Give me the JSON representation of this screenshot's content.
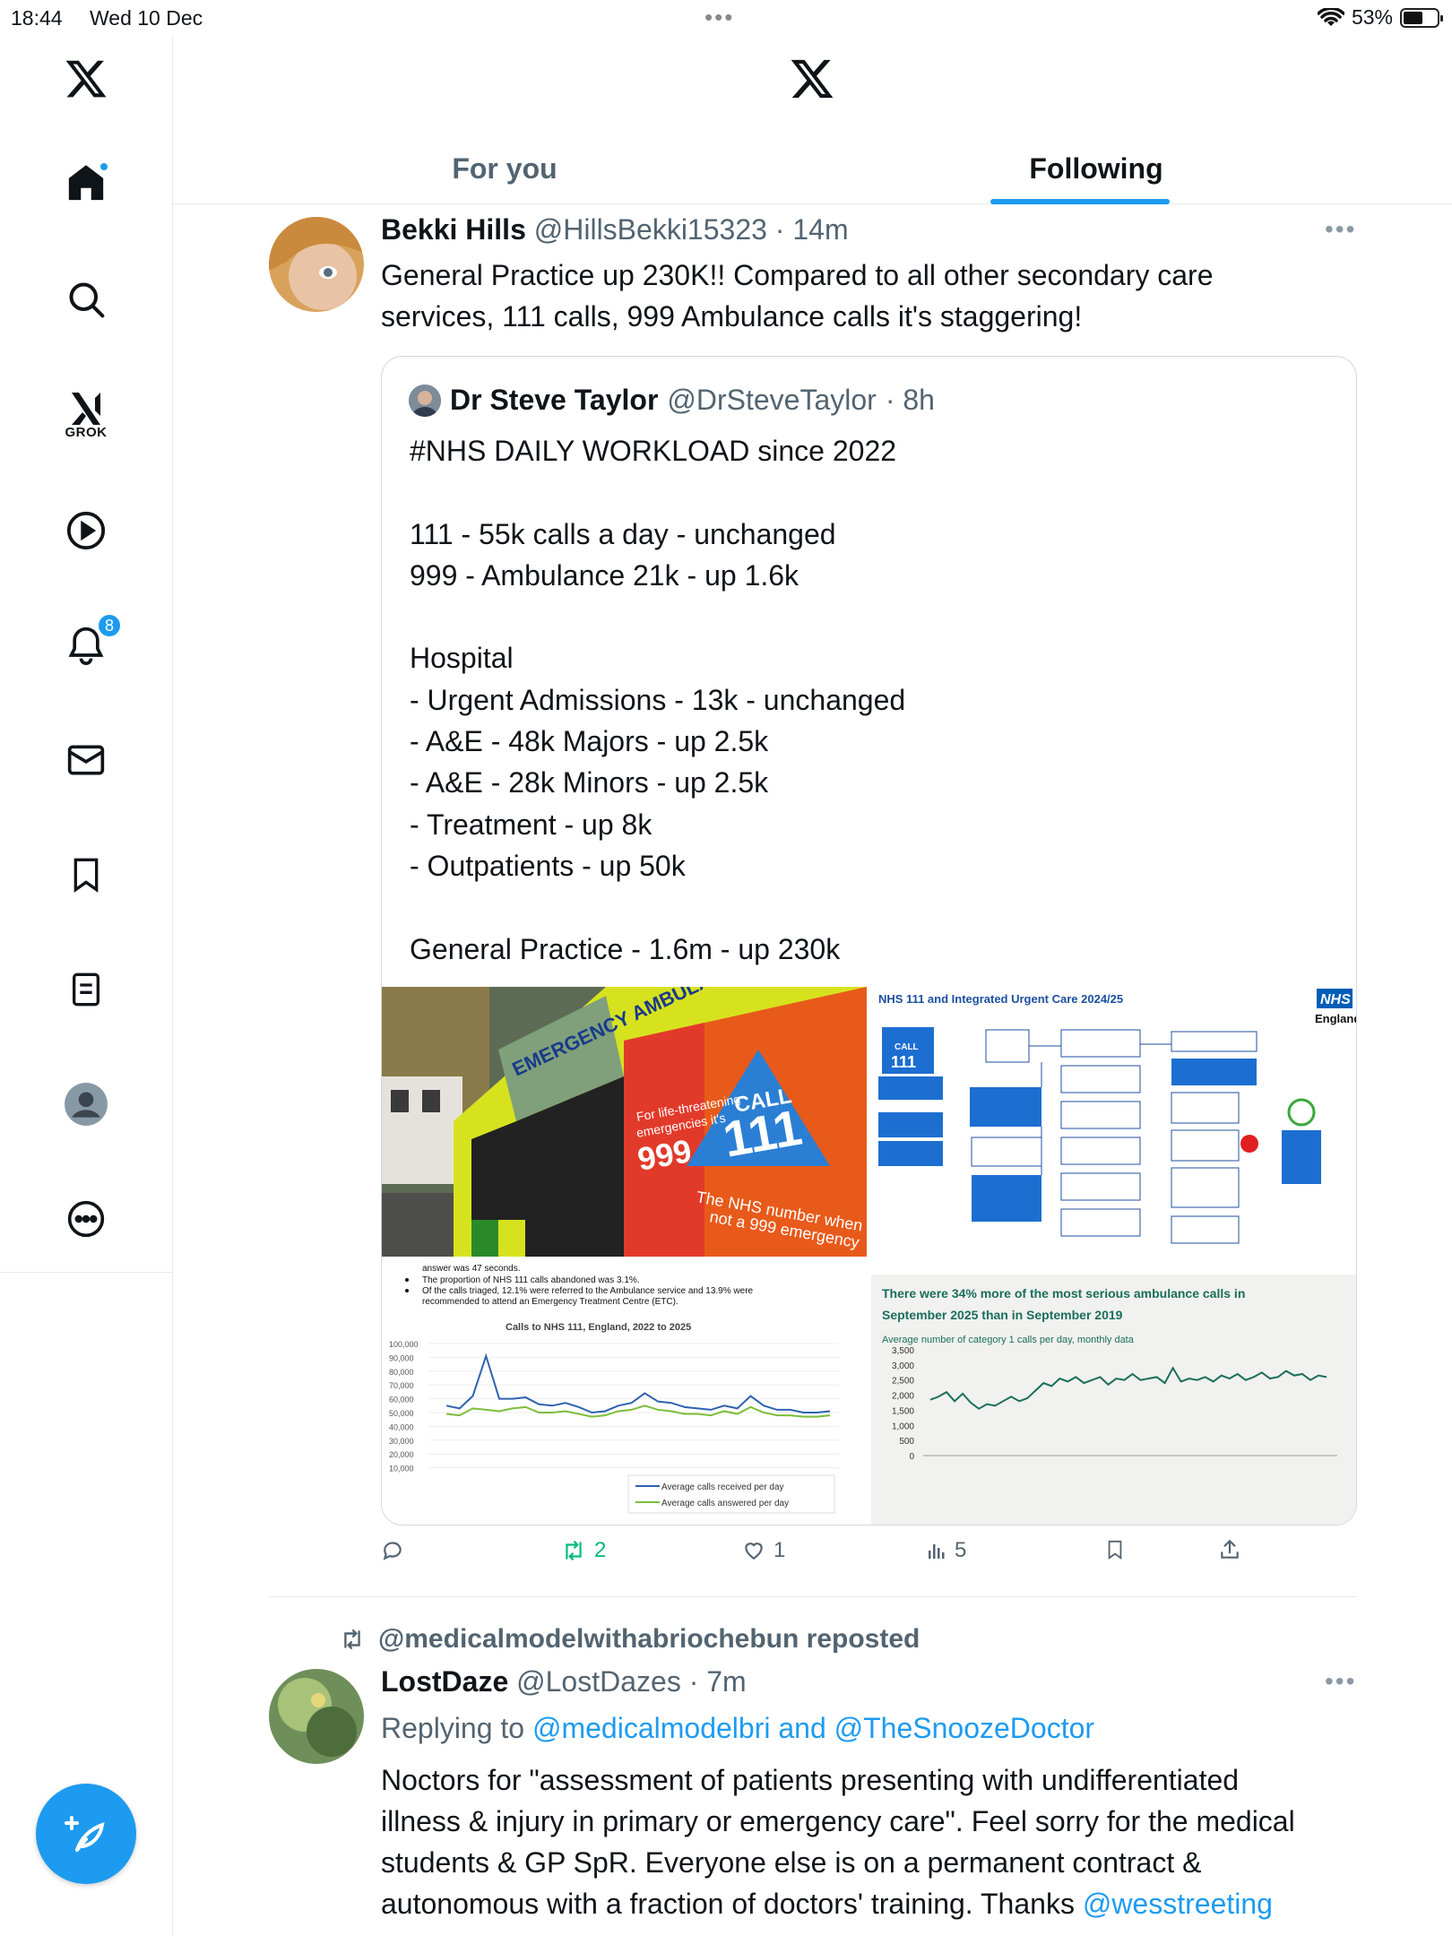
{
  "status_bar": {
    "time": "18:44",
    "date": "Wed 10 Dec",
    "battery": "53%",
    "battery_level": 0.53
  },
  "tabs": [
    {
      "label": "For you",
      "active": false
    },
    {
      "label": "Following",
      "active": true
    }
  ],
  "nav": {
    "notifications_badge": "8",
    "grok_label": "GROK"
  },
  "post1": {
    "author": "Bekki Hills",
    "handle": "@HillsBekki15323",
    "time": "· 14m",
    "text_line1": "General Practice up 230K!! Compared to all other secondary care",
    "text_line2": "services, 111 calls, 999 Ambulance calls it's staggering!",
    "quote": {
      "author": "Dr Steve Taylor",
      "handle": "@DrSteveTaylor",
      "time": "· 8h",
      "text": "#NHS DAILY WORKLOAD since 2022\n\n111 - 55k calls a day - unchanged\n999 - Ambulance 21k - up 1.6k\n\nHospital\n- Urgent Admissions - 13k - unchanged\n- A&E - 48k Majors - up 2.5k\n- A&E - 28k Minors - up 2.5k\n- Treatment - up 8k\n- Outpatients - up 50k\n\nGeneral Practice - 1.6m - up 230k",
      "media": {
        "ambulance": {
          "van_text": "EMERGENCY AMBULANCE",
          "panel_text1": "For life-threatening",
          "panel_text2": "emergencies it's",
          "panel_999": "999",
          "call_label": "CALL",
          "call_number": "111",
          "panel_text3": "The NHS number when it's",
          "panel_text4": "not a 999 emergency"
        },
        "infographic": {
          "title": "NHS 111 and Integrated Urgent Care 2024/25",
          "logo": "NHS",
          "logo_sub": "England",
          "call_label": "CALL",
          "call_number": "111"
        },
        "chart1": {
          "bullet1": "answer was 47 seconds.",
          "bullet2": "The proportion of NHS 111 calls abandoned was 3.1%.",
          "bullet3": "Of the calls triaged, 12.1% were referred to the Ambulance service and 13.9% were",
          "bullet4": "recommended to attend an Emergency Treatment Centre (ETC).",
          "title": "Calls to NHS 111, England, 2022 to 2025",
          "yticks": [
            "100,000",
            "90,000",
            "80,000",
            "70,000",
            "60,000",
            "50,000",
            "40,000",
            "30,000",
            "20,000",
            "10,000"
          ],
          "legend_received": "Average calls received per day",
          "legend_answered": "Average calls answered per day",
          "color_received": "#2e62b0",
          "color_answered": "#7cbd3a"
        },
        "chart2": {
          "title1": "There were 34% more of the most serious ambulance calls in",
          "title2": "September 2025 than in September 2019",
          "subtitle": "Average number of category 1 calls per day, monthly data",
          "yticks": [
            "3,500",
            "3,000",
            "2,500",
            "2,000",
            "1,500",
            "1,000",
            "500",
            "0"
          ],
          "color": "#1a6e5a"
        }
      }
    },
    "actions": {
      "replies": "",
      "reposts": "2",
      "likes": "1",
      "views": "5"
    }
  },
  "chart_data": [
    {
      "type": "line",
      "title": "Calls to NHS 111, England, 2022 to 2025",
      "ylim": [
        0,
        100000
      ],
      "series": [
        {
          "name": "Average calls received per day",
          "values": [
            55000,
            53000,
            62000,
            91000,
            60000,
            60000,
            61000,
            56000,
            55000,
            57000,
            54000,
            50000,
            51000,
            55000,
            57000,
            64000,
            58000,
            57000,
            54000,
            53000,
            52000,
            55000,
            53000,
            62000,
            55000,
            52000,
            52000,
            50000,
            50000,
            51000
          ]
        },
        {
          "name": "Average calls answered per day",
          "values": [
            49000,
            48000,
            53000,
            52000,
            51000,
            53000,
            54000,
            50000,
            50000,
            51000,
            49000,
            47000,
            48000,
            51000,
            52000,
            55000,
            52000,
            51000,
            49000,
            49000,
            48000,
            51000,
            49000,
            54000,
            50000,
            48000,
            48000,
            47000,
            47000,
            48000
          ]
        }
      ]
    },
    {
      "type": "line",
      "title": "There were 34% more of the most serious ambulance calls in September 2025 than in September 2019",
      "ylim": [
        0,
        3500
      ],
      "series": [
        {
          "name": "",
          "values": [
            1850,
            1950,
            2100,
            1800,
            2050,
            1750,
            1550,
            1700,
            1650,
            1800,
            1950,
            1800,
            1900,
            2150,
            2400,
            2300,
            2550,
            2450,
            2600,
            2400,
            2500,
            2600,
            2350,
            2550,
            2500,
            2700,
            2500,
            2550,
            2600,
            2400,
            2900,
            2450,
            2550,
            2500,
            2600,
            2450,
            2650,
            2550,
            2700,
            2500,
            2600,
            2750,
            2550,
            2600,
            2800,
            2650,
            2700,
            2500,
            2650,
            2600
          ]
        }
      ]
    }
  ],
  "post2": {
    "reposted_by": "@medicalmodelwithabriochebun reposted",
    "author": "LostDaze",
    "handle": "@LostDazes",
    "time": "· 7m",
    "replying_prefix": "Replying to",
    "replying_to": "@medicalmodelbri and @TheSnoozeDoctor",
    "text_line1": "Noctors for \"assessment of patients presenting with undifferentiated",
    "text_line2": "illness & injury in primary or emergency care\". Feel sorry for the medical",
    "text_line3": "students & GP SpR. Everyone else is on a permanent contract &",
    "text_line4_prefix": "autonomous with a fraction of doctors' training. Thanks",
    "text_line4_link": "@wesstreeting"
  }
}
